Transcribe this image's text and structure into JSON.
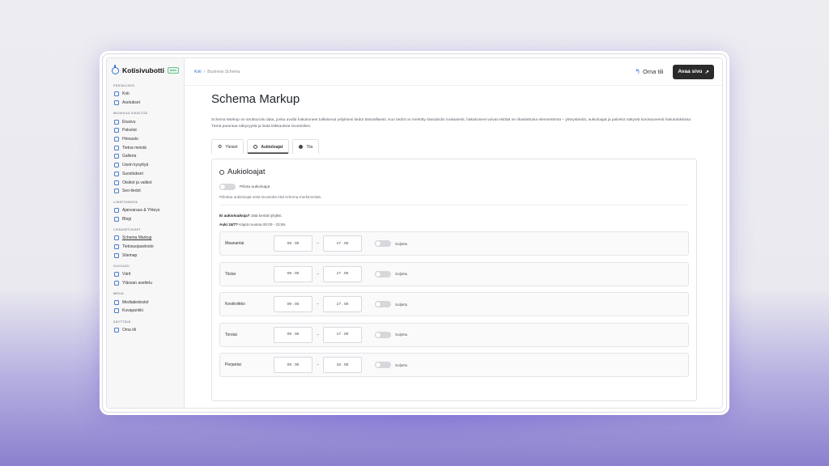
{
  "brand": {
    "name": "Kotisivubotti",
    "badge": "beta"
  },
  "sidebar": {
    "sections": [
      {
        "title": "PÄÄVALIKKO",
        "items": [
          "Koti",
          "Asetukset"
        ]
      },
      {
        "title": "MUOKKAA SISÄLTÖÄ",
        "items": [
          "Etusivu",
          "Palvelut",
          "Hinnasto",
          "Tietoa meistä",
          "Galleria",
          "Usein kysyttyä",
          "Suositukset",
          "Otsikot ja valikot",
          "Seo-tiedot"
        ]
      },
      {
        "title": "LIIKETOIMINTA",
        "items": [
          "Ajanvaraus & Yhteys",
          "Blogi"
        ]
      },
      {
        "title": "LISÄASETUKSET",
        "items": [
          "Schema Markup",
          "Tietosuojaseloste",
          "Sitemap"
        ]
      },
      {
        "title": "ULKOASU",
        "items": [
          "Värit",
          "Yläosan asettelu"
        ]
      },
      {
        "title": "MEDIA",
        "items": [
          "Mediatiedostot",
          "Kuvapankki"
        ]
      },
      {
        "title": "KÄYTTÄJÄ",
        "items": [
          "Oma tili"
        ]
      }
    ],
    "active": "Schema Markup"
  },
  "breadcrumb": {
    "home": "Koti",
    "separator": "›",
    "current": "Business Schema"
  },
  "header": {
    "account": "Oma tili",
    "open_site": "Avaa sivu"
  },
  "page": {
    "title": "Schema Markup",
    "description": "Schema Markup on strukturoitu data, jonka avulla hakukoneet tulkitsevat yrityksesi tiedot täsmällisesti. Kun tiedot on merkitty standardin mukaisesti, hakukoneet voivat esittää ne rikastettuina elementteinä – yhteystiedot, aukioloajat ja palvelut näkyvät korostuneesti hakutuloksissa. Tämä parantaa näkyvyyttä ja lisää klikkauksia sivustollesi."
  },
  "tabs": [
    {
      "label": "Yleiset",
      "icon": "gear-icon"
    },
    {
      "label": "Aukioloajat",
      "icon": "clock-icon",
      "active": true
    },
    {
      "label": "Tila",
      "icon": "check-circle-icon"
    }
  ],
  "card": {
    "title": "Aukioloajat",
    "hide_toggle_label": "Piilota aukioloajat",
    "hide_help": "Piilottaa aukioloajat sekä sivustolta että schema-merkinnöistä.",
    "note1_bold": "Ei aukioloaikoja?",
    "note1_text": " Jätä kentät tyhjiksi.",
    "note2_bold": "Auki 24/7?",
    "note2_text": " Käytä muotoa 00:00 - 23:59.",
    "closed_label": "Suljettu",
    "days": [
      {
        "name": "Maanantai",
        "open": "09 . 00",
        "close": "17 . 00"
      },
      {
        "name": "Tiistai",
        "open": "09 . 00",
        "close": "17 . 00"
      },
      {
        "name": "Keskiviikko",
        "open": "09 . 00",
        "close": "17 . 00"
      },
      {
        "name": "Torstai",
        "open": "09 . 00",
        "close": "17 . 00"
      },
      {
        "name": "Perjantai",
        "open": "09 . 00",
        "close": "16 . 00"
      }
    ]
  }
}
